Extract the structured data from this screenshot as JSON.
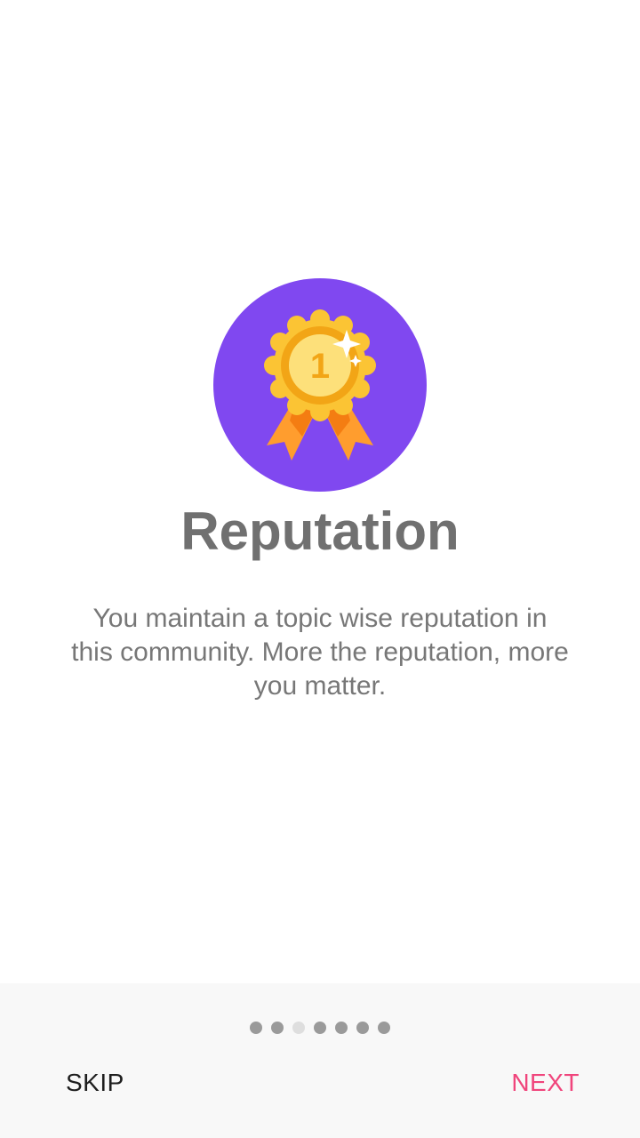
{
  "slide": {
    "icon": "medal-ribbon-icon",
    "medal_number": "1",
    "title": "Reputation",
    "description": "You maintain a topic wise reputation in this community. More the reputation, more you matter."
  },
  "pager": {
    "total_pages": 7,
    "current_page": 3
  },
  "footer": {
    "skip_label": "SKIP",
    "next_label": "NEXT"
  },
  "colors": {
    "circle_bg": "#8048f0",
    "medal_outer": "#fbc434",
    "medal_inner": "#f2a516",
    "medal_core": "#fde07a",
    "ribbon_light": "#ff9d2e",
    "ribbon_dark": "#f47d12",
    "next_accent": "#f0457c",
    "dot_inactive": "#9a9a9a",
    "dot_active": "#dedede"
  }
}
